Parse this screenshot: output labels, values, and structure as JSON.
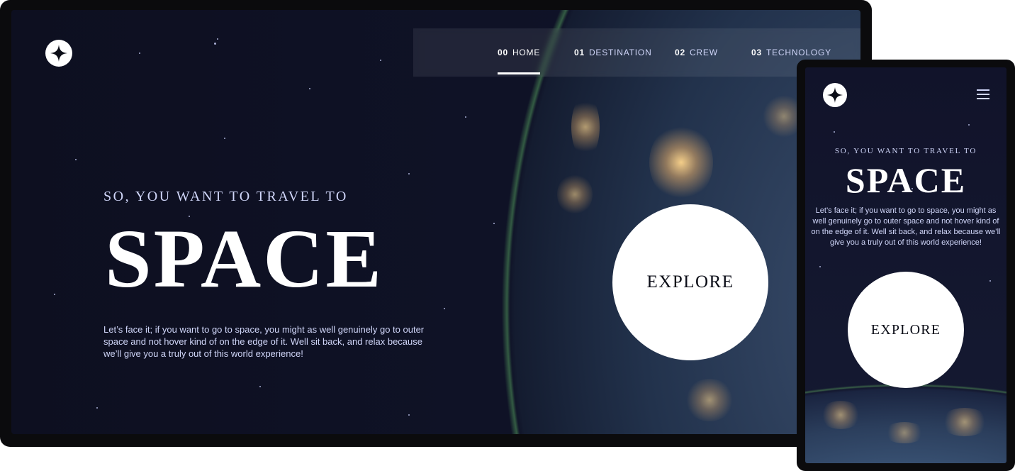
{
  "colors": {
    "background_dark": "#0b0d17",
    "text_light": "#d0d6f9",
    "white": "#ffffff"
  },
  "desktop": {
    "logo_icon": "star-icon",
    "nav": [
      {
        "num": "00",
        "label": "HOME",
        "active": true
      },
      {
        "num": "01",
        "label": "DESTINATION",
        "active": false
      },
      {
        "num": "02",
        "label": "CREW",
        "active": false
      },
      {
        "num": "03",
        "label": "TECHNOLOGY",
        "active": false
      }
    ],
    "kicker": "SO, YOU WANT TO TRAVEL TO",
    "title": "SPACE",
    "body": "Let’s face it; if you want to go to space, you might as well genuinely go to outer space and not hover kind of on the edge of it. Well sit back, and relax because we’ll give you a truly out of this world experience!",
    "explore_label": "EXPLORE"
  },
  "mobile": {
    "logo_icon": "star-icon",
    "menu_icon": "hamburger-icon",
    "kicker": "SO, YOU WANT TO TRAVEL TO",
    "title": "SPACE",
    "body": "Let’s face it; if you want to go to space, you might as well genuinely go to outer space and not hover kind of on the edge of it. Well sit back, and relax because we’ll give you a truly out of this world experience!",
    "explore_label": "EXPLORE"
  }
}
